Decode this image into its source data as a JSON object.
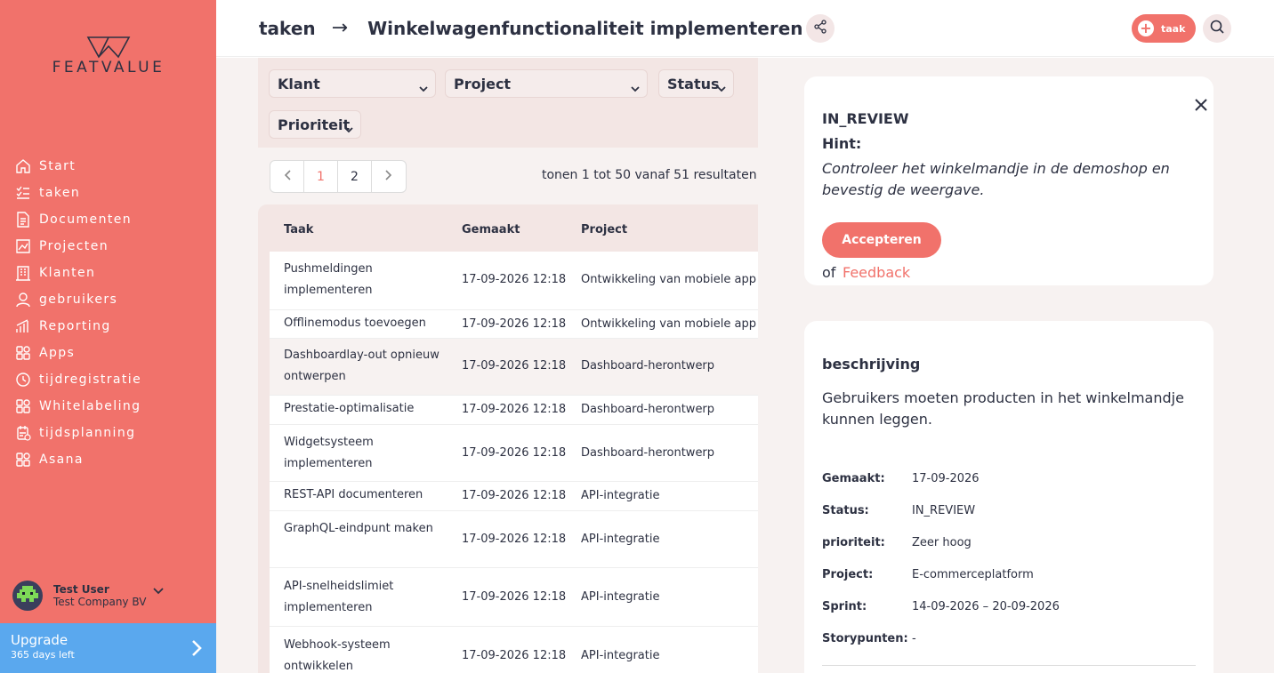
{
  "brand": {
    "logo_text": "FEATVALUE"
  },
  "sidebar": {
    "items": [
      {
        "label": "Start",
        "icon": "home-icon"
      },
      {
        "label": "taken",
        "icon": "task-list-icon"
      },
      {
        "label": "Documenten",
        "icon": "document-icon"
      },
      {
        "label": "Projecten",
        "icon": "chart-icon"
      },
      {
        "label": "Klanten",
        "icon": "building-icon"
      },
      {
        "label": "gebruikers",
        "icon": "user-icon"
      },
      {
        "label": "Reporting",
        "icon": "bar-chart-icon"
      },
      {
        "label": "Apps",
        "icon": "apps-icon"
      },
      {
        "label": "tijdregistratie",
        "icon": "clock-icon"
      },
      {
        "label": "Whitelabeling",
        "icon": "apps-icon"
      },
      {
        "label": "tijdsplanning",
        "icon": "calendar-icon"
      },
      {
        "label": "Asana",
        "icon": "apps-icon"
      }
    ],
    "user": {
      "name": "Test User",
      "company": "Test Company BV"
    },
    "upgrade": {
      "title": "Upgrade",
      "subtitle": "365 days left"
    }
  },
  "header": {
    "crumb_parent": "taken",
    "crumb_arrow": "→",
    "crumb_current": "Winkelwagenfunctionaliteit implementeren",
    "new_task_label": "taak"
  },
  "filters": {
    "client": "Klant",
    "project": "Project",
    "status": "Status",
    "priority": "Prioriteit"
  },
  "pagination": {
    "pages": [
      "1",
      "2"
    ],
    "active_page": "1",
    "results_text": "tonen 1 tot 50 vanaf 51 resultaten"
  },
  "table": {
    "columns": [
      "Taak",
      "Gemaakt",
      "Project"
    ],
    "rows": [
      {
        "task": "Pushmeldingen implementeren",
        "created": "17-09-2026 12:18",
        "project": "Ontwikkeling van mobiele app"
      },
      {
        "task": "Offlinemodus toevoegen",
        "created": "17-09-2026 12:18",
        "project": "Ontwikkeling van mobiele app"
      },
      {
        "task": "Dashboardlay-out opnieuw ontwerpen",
        "created": "17-09-2026 12:18",
        "project": "Dashboard-herontwerp"
      },
      {
        "task": "Prestatie-optimalisatie",
        "created": "17-09-2026 12:18",
        "project": "Dashboard-herontwerp"
      },
      {
        "task": "Widgetsysteem implementeren",
        "created": "17-09-2026 12:18",
        "project": "Dashboard-herontwerp"
      },
      {
        "task": "REST-API documenteren",
        "created": "17-09-2026 12:18",
        "project": "API-integratie"
      },
      {
        "task": "GraphQL-eindpunt maken",
        "created": "17-09-2026 12:18",
        "project": "API-integratie"
      },
      {
        "task": "API-snelheidslimiet implementeren",
        "created": "17-09-2026 12:18",
        "project": "API-integratie"
      },
      {
        "task": "Webhook-systeem ontwikkelen",
        "created": "17-09-2026 12:18",
        "project": "API-integratie"
      }
    ]
  },
  "review": {
    "status": "IN_REVIEW",
    "hint_label": "Hint:",
    "hint_text": "Controleer het winkelmandje in de demoshop en bevestig de weergave.",
    "accept_label": "Accepteren",
    "or_text": "of",
    "feedback_label": "Feedback"
  },
  "details": {
    "title": "beschrijving",
    "description": "Gebruikers moeten producten in het winkelmandje kunnen leggen.",
    "fields": [
      {
        "key": "Gemaakt:",
        "value": "17-09-2026"
      },
      {
        "key": "Status:",
        "value": "IN_REVIEW"
      },
      {
        "key": "prioriteit:",
        "value": "Zeer hoog"
      },
      {
        "key": "Project:",
        "value": "E-commerceplatform"
      },
      {
        "key": "Sprint:",
        "value": "14-09-2026 – 20-09-2026"
      },
      {
        "key": "Storypunten:",
        "value": "-"
      }
    ]
  },
  "colors": {
    "accent": "#f1726b",
    "upgrade": "#5aa8ee",
    "text": "#2d3142",
    "background": "#f7f2f1"
  }
}
